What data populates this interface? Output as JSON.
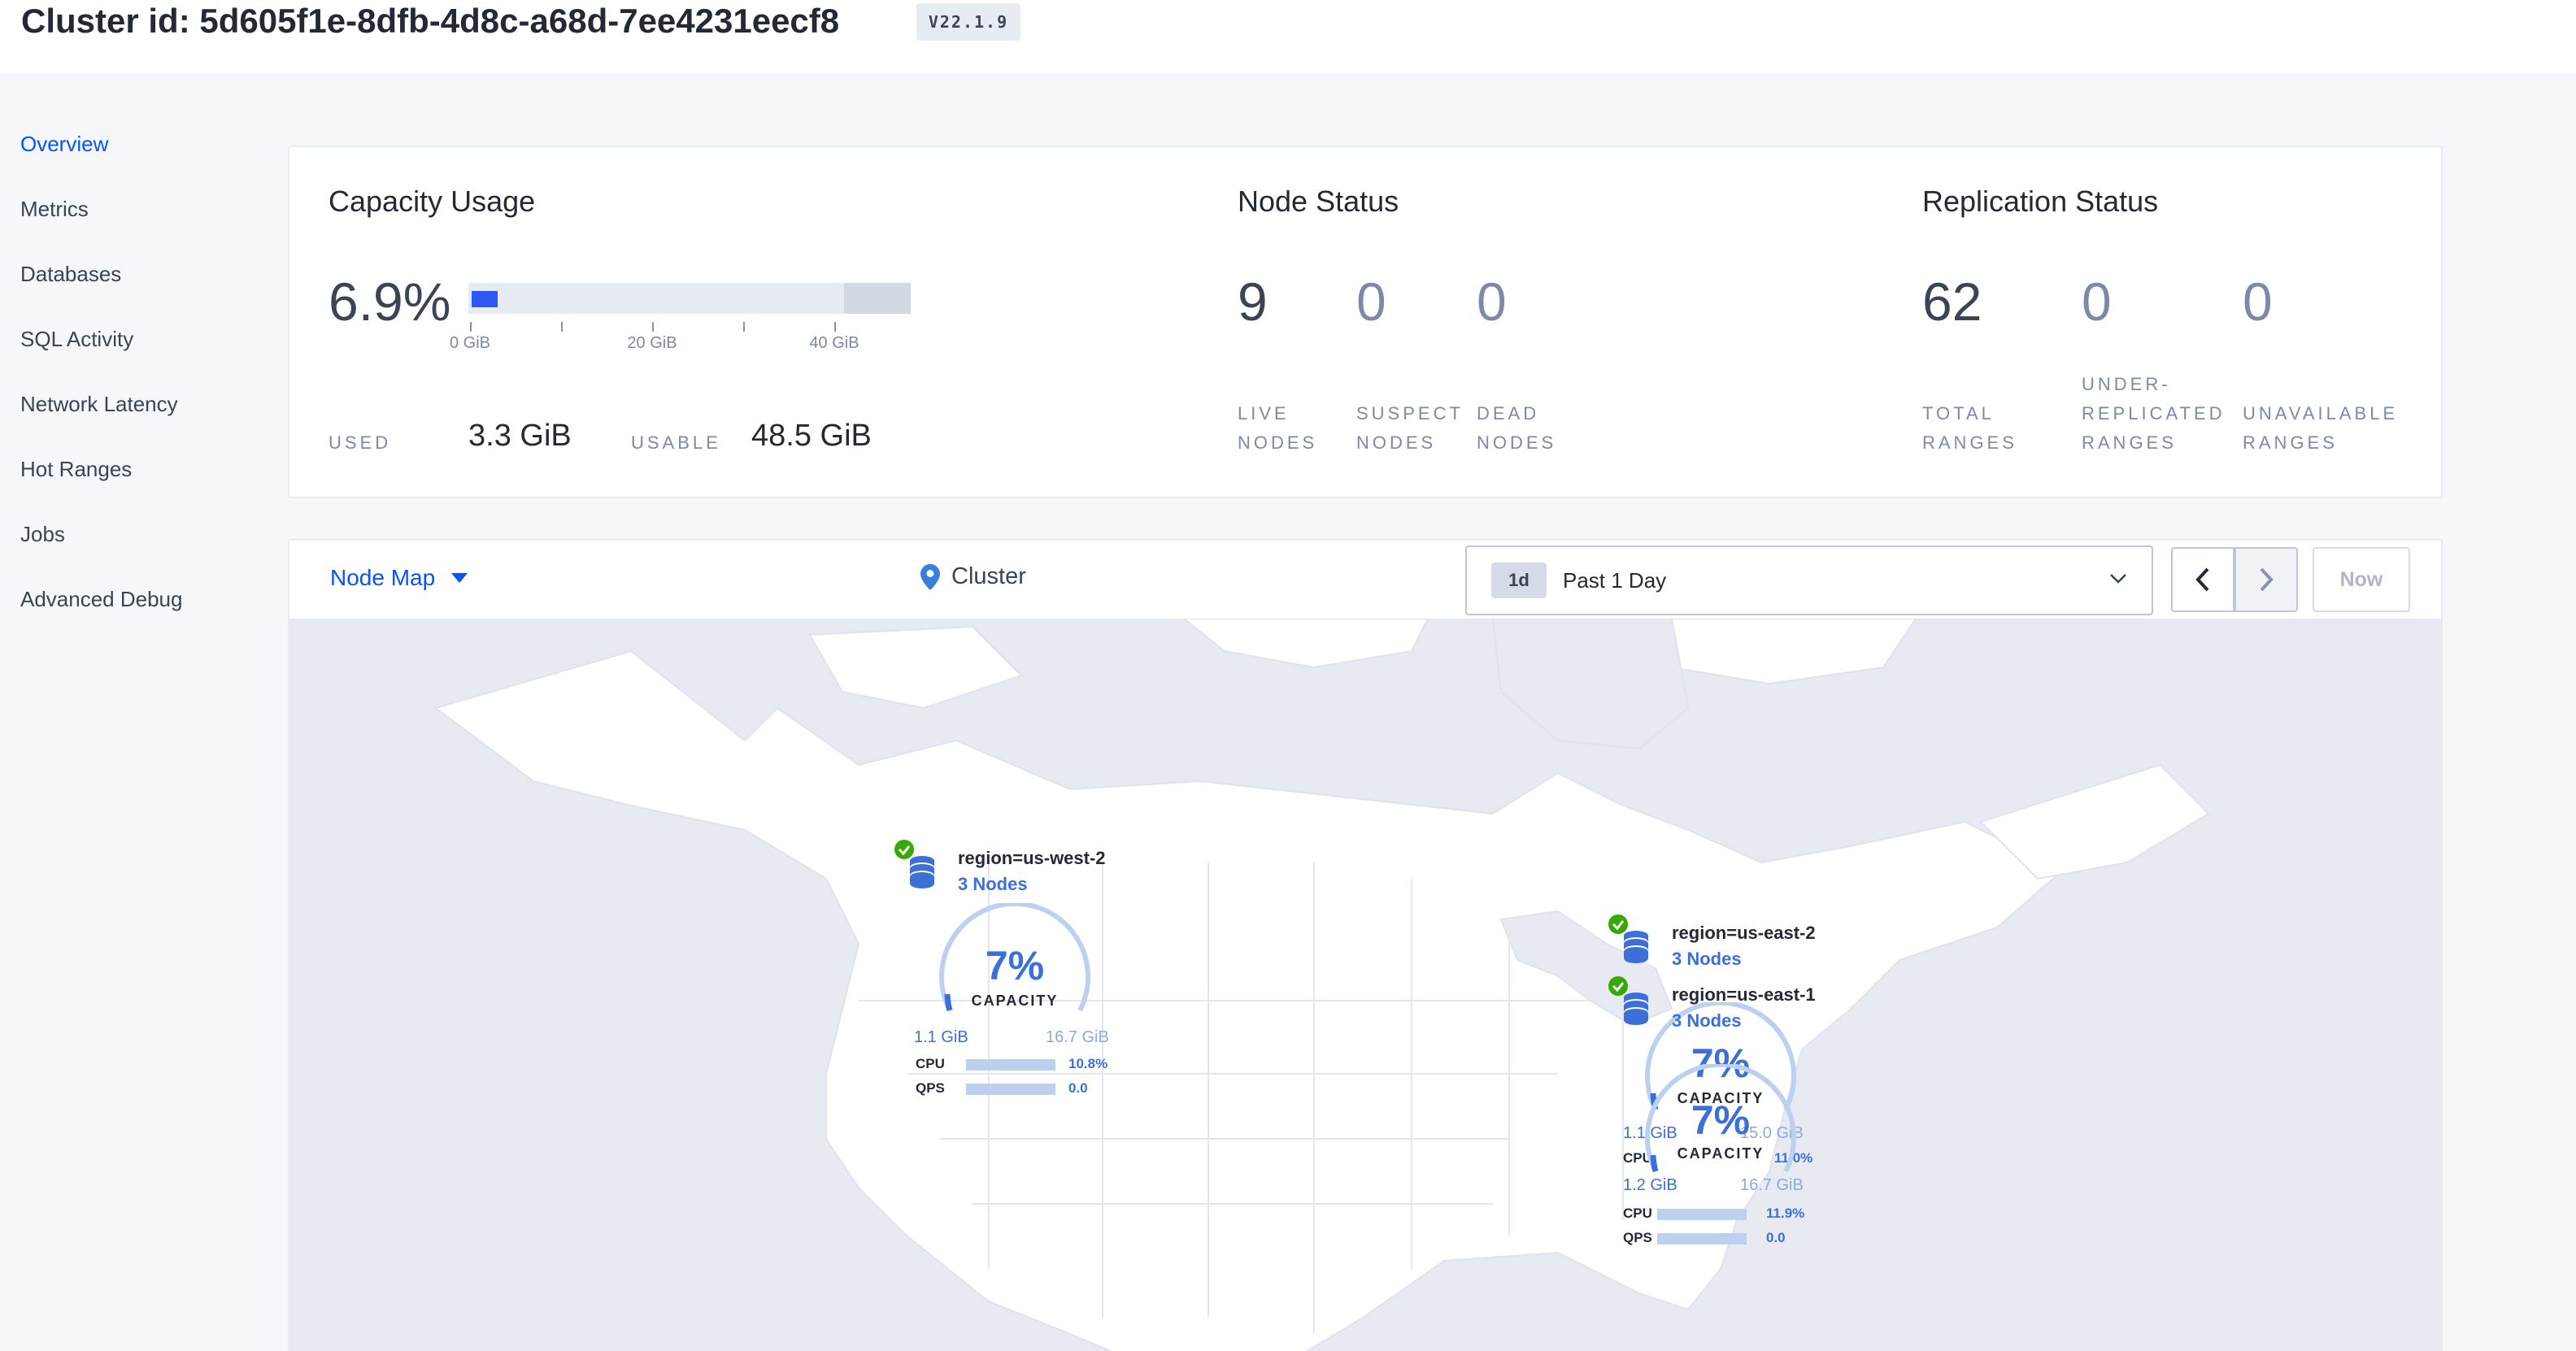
{
  "header": {
    "title": "Cluster id: 5d605f1e-8dfb-4d8c-a68d-7ee4231eecf8",
    "version": "V22.1.9"
  },
  "sidebar": {
    "items": [
      {
        "label": "Overview",
        "active": true
      },
      {
        "label": "Metrics"
      },
      {
        "label": "Databases"
      },
      {
        "label": "SQL Activity"
      },
      {
        "label": "Network Latency"
      },
      {
        "label": "Hot Ranges"
      },
      {
        "label": "Jobs"
      },
      {
        "label": "Advanced Debug"
      }
    ]
  },
  "capacity": {
    "heading": "Capacity Usage",
    "percent": "6.9%",
    "used_fraction": 0.069,
    "ticks": [
      "0 GiB",
      "20 GiB",
      "40 GiB"
    ],
    "used_label": "USED",
    "used_value": "3.3 GiB",
    "usable_label": "USABLE",
    "usable_value": "48.5 GiB"
  },
  "node_status": {
    "heading": "Node Status",
    "live": "9",
    "suspect": "0",
    "dead": "0",
    "live_label": "LIVE NODES",
    "suspect_label": "SUSPECT NODES",
    "dead_label": "DEAD NODES"
  },
  "replication": {
    "heading": "Replication Status",
    "total": "62",
    "under": "0",
    "unavailable": "0",
    "total_label": "TOTAL RANGES",
    "under_label": "UNDER-REPLICATED RANGES",
    "unavailable_label": "UNAVAILABLE RANGES"
  },
  "toolbar": {
    "view": "Node Map",
    "breadcrumb": "Cluster",
    "time_badge": "1d",
    "time_label": "Past 1 Day",
    "now_label": "Now"
  },
  "map": {
    "capacity_label": "CAPACITY",
    "cpu_label": "CPU",
    "qps_label": "QPS",
    "regions": [
      {
        "name": "region=us-west-2",
        "nodes": "3 Nodes",
        "capacity": "7%",
        "used": "1.1 GiB",
        "total": "16.7 GiB",
        "cpu": "10.8%",
        "qps": "0.0"
      },
      {
        "name": "region=us-east-2",
        "nodes": "3 Nodes",
        "capacity": "7%",
        "used": "1.1 GiB",
        "total": "15.0 GiB",
        "cpu": "11.0%",
        "qps": "0.0"
      },
      {
        "name": "region=us-east-1",
        "nodes": "3 Nodes",
        "capacity": "7%",
        "used": "1.2 GiB",
        "total": "16.7 GiB",
        "cpu": "11.9%",
        "qps": "0.0"
      }
    ]
  },
  "colors": {
    "accent": "#0055ff",
    "bar_used": "#2c59f5",
    "healthy": "#37a806",
    "map_land": "#ffffff",
    "map_water": "#e8eaf2"
  }
}
